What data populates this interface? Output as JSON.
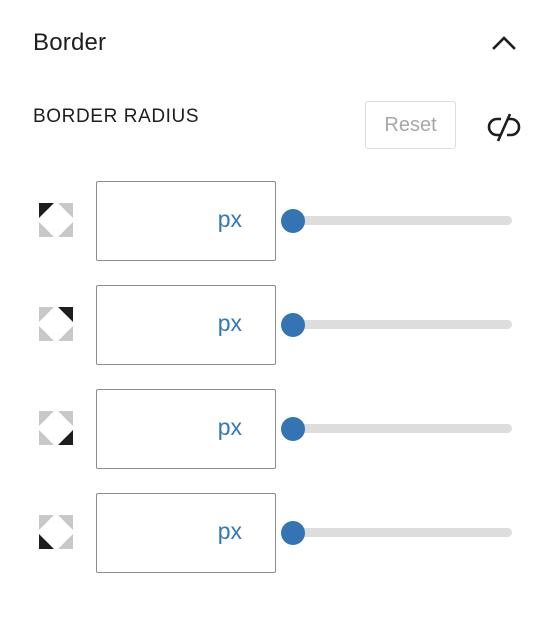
{
  "panel": {
    "title": "Border",
    "collapse_icon": "chevron-up-icon"
  },
  "border_radius": {
    "label": "BORDER RADIUS",
    "reset_label": "Reset",
    "link_icon": "unlink-icon",
    "corners": [
      {
        "corner": "top-left",
        "icon": "corner-top-left-icon",
        "value": "",
        "unit": "px",
        "slider_value": 0
      },
      {
        "corner": "top-right",
        "icon": "corner-top-right-icon",
        "value": "",
        "unit": "px",
        "slider_value": 0
      },
      {
        "corner": "bottom-right",
        "icon": "corner-bottom-right-icon",
        "value": "",
        "unit": "px",
        "slider_value": 0
      },
      {
        "corner": "bottom-left",
        "icon": "corner-bottom-left-icon",
        "value": "",
        "unit": "px",
        "slider_value": 0
      }
    ]
  },
  "colors": {
    "accent": "#3474b3",
    "unit_text": "#3377b7",
    "track": "#dddddd",
    "input_border": "#8c8c8c",
    "reset_text": "#a7a7a7"
  }
}
